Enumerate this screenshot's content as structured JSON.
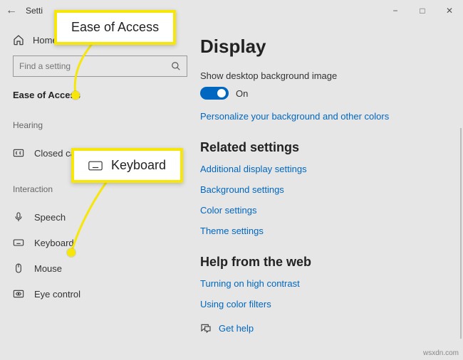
{
  "titlebar": {
    "app": "Setti"
  },
  "sidebar": {
    "home": "Home",
    "search_placeholder": "Find a setting",
    "category": "Ease of Access",
    "section_hearing": "Hearing",
    "section_interaction": "Interaction",
    "items": {
      "closed_cap": "Closed cap",
      "speech": "Speech",
      "keyboard": "Keyboard",
      "mouse": "Mouse",
      "eye_control": "Eye control"
    }
  },
  "main": {
    "title": "Display",
    "bg_label": "Show desktop background image",
    "toggle_state": "On",
    "link_personalize": "Personalize your background and other colors",
    "related_heading": "Related settings",
    "link_additional": "Additional display settings",
    "link_background": "Background settings",
    "link_color": "Color settings",
    "link_theme": "Theme settings",
    "help_heading": "Help from the web",
    "link_high_contrast": "Turning on high contrast",
    "link_color_filters": "Using color filters",
    "get_help": "Get help"
  },
  "callouts": {
    "ease": "Ease of Access",
    "keyboard": "Keyboard"
  },
  "watermark": "wsxdn.com"
}
